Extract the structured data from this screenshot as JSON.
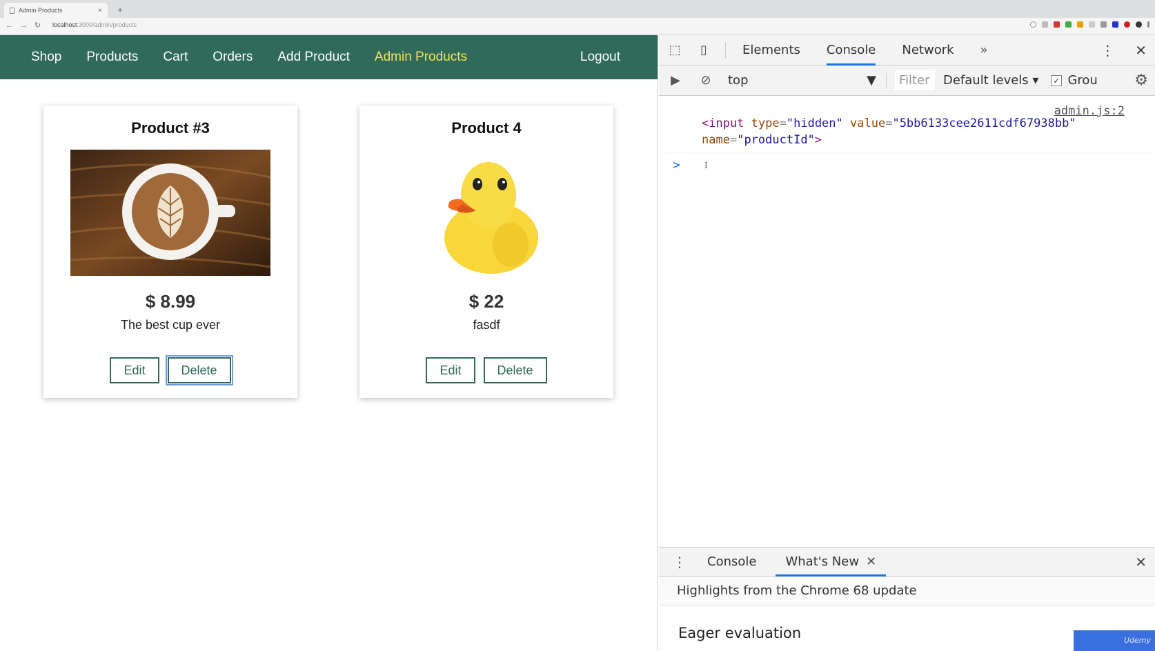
{
  "browser": {
    "tab_title": "Admin Products",
    "tab_close": "×",
    "new_tab": "+",
    "url_host": "localhost",
    "url_rest": ":3000/admin/products"
  },
  "nav": {
    "items": [
      "Shop",
      "Products",
      "Cart",
      "Orders",
      "Add Product",
      "Admin Products"
    ],
    "active": "Admin Products",
    "logout": "Logout"
  },
  "products": [
    {
      "title": "Product #3",
      "price": "$ 8.99",
      "description": "The best cup ever",
      "edit_label": "Edit",
      "delete_label": "Delete"
    },
    {
      "title": "Product 4",
      "price": "$ 22",
      "description": "fasdf",
      "edit_label": "Edit",
      "delete_label": "Delete"
    }
  ],
  "devtools": {
    "tabs": [
      "Elements",
      "Console",
      "Network"
    ],
    "active_tab": "Console",
    "more": "»",
    "context": "top",
    "filter_placeholder": "Filter",
    "levels": "Default levels",
    "group_label": "Grou",
    "console_message": {
      "source": "admin.js:2",
      "tag_open": "<input",
      "attr1_name": "type",
      "attr1_value": "\"hidden\"",
      "attr2_name": "value",
      "attr2_value": "\"5bb6133cee2611cdf67938bb\"",
      "attr3_name": "name",
      "attr3_value": "\"productId\"",
      "tag_close": ">"
    },
    "prompt": ">",
    "drawer": {
      "tabs": [
        "Console",
        "What's New"
      ],
      "active_tab": "What's New",
      "highlights": "Highlights from the Chrome 68 update",
      "section": "Eager evaluation"
    }
  },
  "colors": {
    "nav_bg": "#2f6a5a",
    "nav_active": "#f4e45c",
    "devtools_accent": "#1a73e8"
  }
}
